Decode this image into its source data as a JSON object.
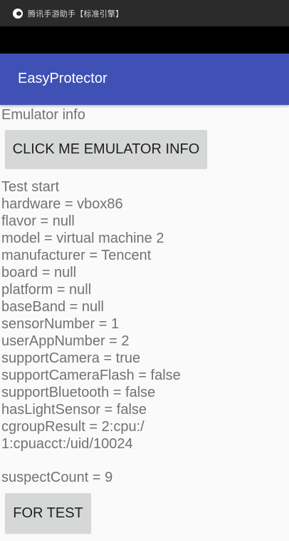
{
  "window": {
    "title": "腾讯手游助手【标准引擎】",
    "icon": "tencent-gamebuddy-icon"
  },
  "appbar": {
    "title": "EasyProtector",
    "color": "#3f51b5"
  },
  "main": {
    "section_label": "Emulator info",
    "emulator_button_label": "CLICK ME EMULATOR INFO",
    "info_lines": [
      "Test start",
      "hardware = vbox86",
      "flavor = null",
      "model = virtual machine 2",
      "manufacturer = Tencent",
      "board = null",
      "platform = null",
      "baseBand = null",
      "sensorNumber = 1",
      "userAppNumber = 2",
      "supportCamera = true",
      "supportCameraFlash = false",
      "supportBluetooth = false",
      "hasLightSensor = false",
      "cgroupResult = 2:cpu:/",
      "1:cpuacct:/uid/10024"
    ],
    "suspect_count": "suspectCount = 9",
    "test_button_label": "FOR TEST"
  }
}
